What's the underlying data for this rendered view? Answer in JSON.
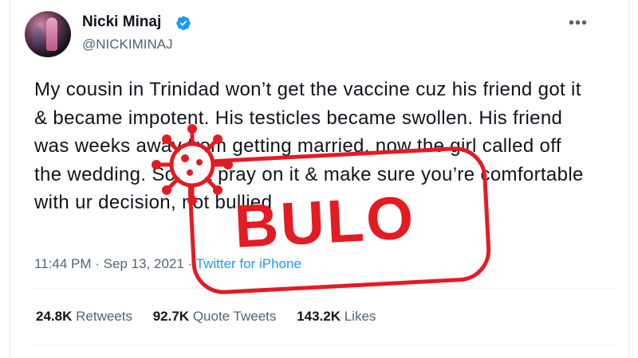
{
  "tweet": {
    "author_name": "Nicki Minaj",
    "handle": "@NICKIMINAJ",
    "more_icon": "more-horizontal-icon",
    "text": "My cousin in Trinidad won’t get the vaccine cuz his friend got it & became impotent. His testicles became swollen. His friend was weeks away from getting married, now the girl called off the wedding. So just pray on it & make sure you’re comfortable with ur decision, not bullied",
    "time": "11:44 PM",
    "separator": "·",
    "date": "Sep 13, 2021",
    "source": "Twitter for iPhone"
  },
  "stats": {
    "retweets_count": "24.8K",
    "retweets_label": "Retweets",
    "quotes_count": "92.7K",
    "quotes_label": "Quote Tweets",
    "likes_count": "143.2K",
    "likes_label": "Likes"
  },
  "stamp": {
    "word": "BULO",
    "color": "#e31b23"
  },
  "colors": {
    "verified": "#1d9bf0",
    "muted": "#536471",
    "text": "#0f1419"
  }
}
